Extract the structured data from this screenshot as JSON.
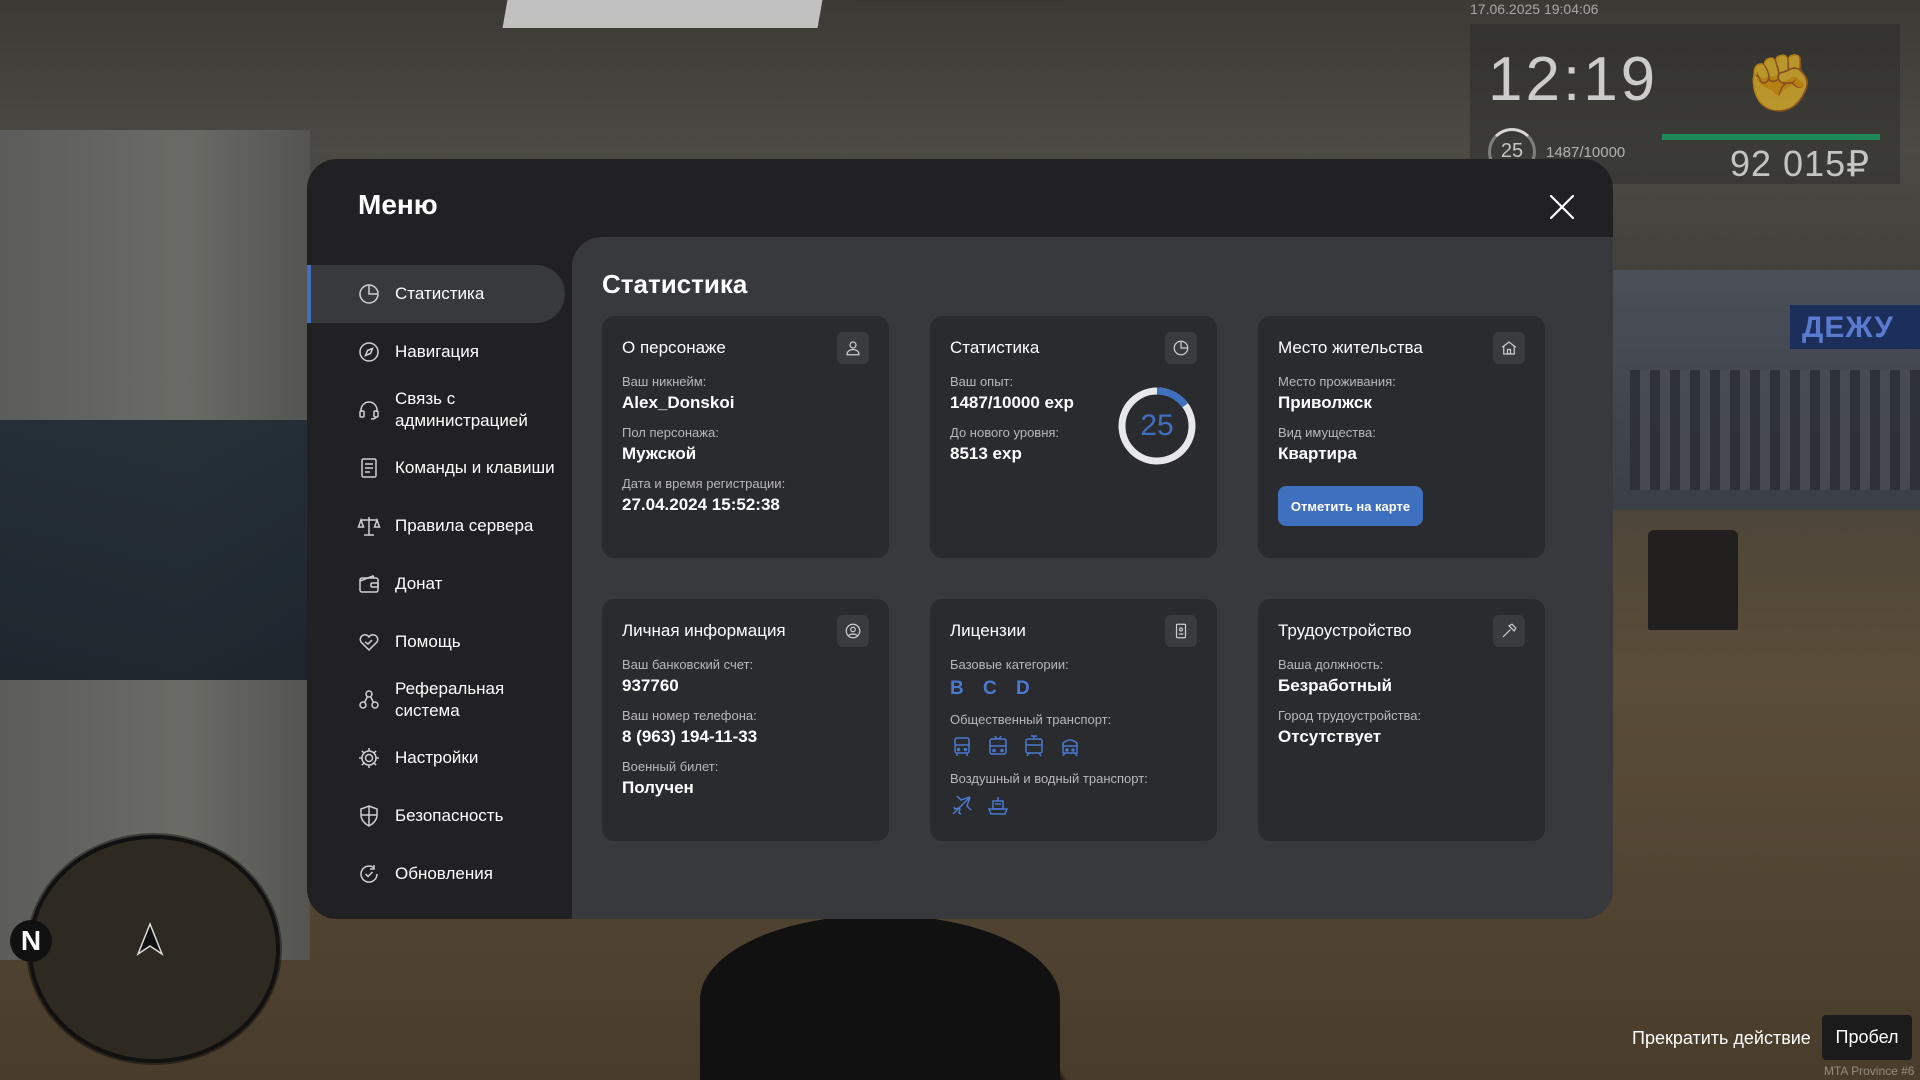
{
  "hud": {
    "datetime": "17.06.2025 19:04:06",
    "time": "12:19",
    "level": "25",
    "exp": "1487/10000",
    "money": "92 015₽",
    "fist_icon": "fist-icon"
  },
  "minimap": {
    "north": "N"
  },
  "action": {
    "stop_label": "Прекратить действие",
    "key_label": "Пробел"
  },
  "watermark": "MTA Province #6",
  "background": {
    "sign_text": "ДЕЖУ"
  },
  "menu": {
    "title": "Меню",
    "nav": [
      {
        "label": "Статистика",
        "icon": "pie-chart-icon"
      },
      {
        "label": "Навигация",
        "icon": "compass-icon"
      },
      {
        "label": "Связь с администрацией",
        "icon": "headset-icon"
      },
      {
        "label": "Команды и клавиши",
        "icon": "document-list-icon"
      },
      {
        "label": "Правила сервера",
        "icon": "scales-icon"
      },
      {
        "label": "Донат",
        "icon": "wallet-icon"
      },
      {
        "label": "Помощь",
        "icon": "heart-handshake-icon"
      },
      {
        "label": "Реферальная система",
        "icon": "people-network-icon"
      },
      {
        "label": "Настройки",
        "icon": "gear-icon"
      },
      {
        "label": "Безопасность",
        "icon": "shield-icon"
      },
      {
        "label": "Обновления",
        "icon": "refresh-check-icon"
      }
    ],
    "active_index": 0
  },
  "content": {
    "title": "Статистика",
    "character": {
      "title": "О персонаже",
      "nickname_label": "Ваш никнейм:",
      "nickname": "Alex_Donskoi",
      "gender_label": "Пол персонажа:",
      "gender": "Мужской",
      "reg_label": "Дата и время регистрации:",
      "reg_date": "27.04.2024 15:52:38"
    },
    "stats": {
      "title": "Статистика",
      "exp_label": "Ваш опыт:",
      "exp": "1487/10000 exp",
      "next_label": "До нового уровня:",
      "next": "8513 exp",
      "level": "25",
      "progress": 0.1487
    },
    "residence": {
      "title": "Место жительства",
      "place_label": "Место проживания:",
      "place": "Приволжск",
      "property_label": "Вид имущества:",
      "property": "Квартира",
      "map_button": "Отметить на карте"
    },
    "personal": {
      "title": "Личная информация",
      "bank_label": "Ваш банковский счет:",
      "bank": "937760",
      "phone_label": "Ваш номер телефона:",
      "phone": "8 (963) 194-11-33",
      "military_label": "Военный билет:",
      "military": "Получен"
    },
    "licenses": {
      "title": "Лицензии",
      "basic_label": "Базовые категории:",
      "basic": [
        "B",
        "C",
        "D"
      ],
      "public_label": "Общественный транспорт:",
      "public_icons": [
        "bus-icon",
        "trolleybus-icon",
        "tram-icon",
        "train-icon"
      ],
      "air_label": "Воздушный и водный транспорт:",
      "air_icons": [
        "plane-icon",
        "boat-icon"
      ]
    },
    "employment": {
      "title": "Трудоустройство",
      "position_label": "Ваша должность:",
      "position": "Безработный",
      "city_label": "Город трудоустройства:",
      "city": "Отсутствует"
    }
  },
  "colors": {
    "accent": "#3f6fbf",
    "panel": "#212123",
    "content": "#38393c",
    "card": "#2a2b2e"
  }
}
